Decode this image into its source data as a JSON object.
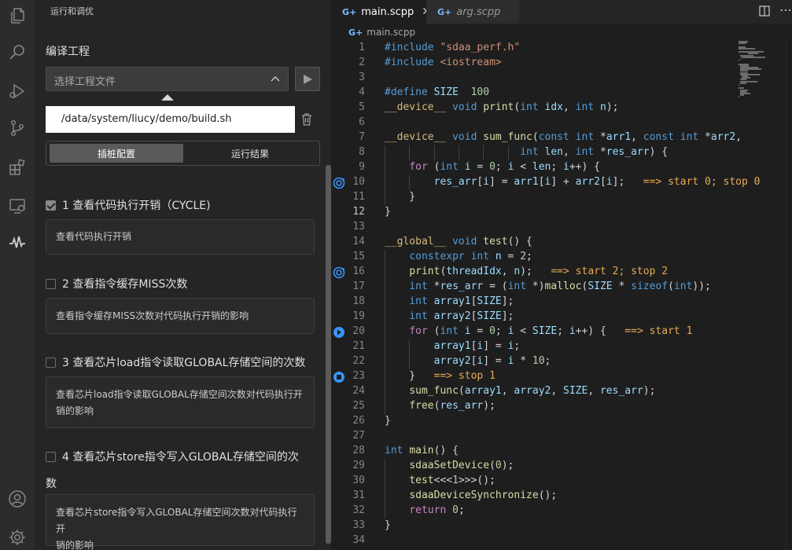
{
  "activity_bar": {
    "icons": [
      "files-icon",
      "search-icon",
      "run-debug-icon",
      "source-control-icon",
      "extensions-icon",
      "remote-explorer-icon",
      "waveform-icon",
      "account-icon",
      "settings-gear-icon"
    ]
  },
  "sidebar": {
    "title": "运行和调优",
    "section_title": "编译工程",
    "select_placeholder": "选择工程文件",
    "path_value": "/data/system/liucy/demo/build.sh",
    "tabs": [
      {
        "label": "插桩配置",
        "active": true
      },
      {
        "label": "运行结果",
        "active": false
      }
    ],
    "items": [
      {
        "title": "1 查看代码执行开销（CYCLE)",
        "checked": true,
        "desc": [
          "查看代码执行开销"
        ]
      },
      {
        "title": "2 查看指令缓存MISS次数",
        "checked": false,
        "desc": [
          "查看指令缓存MISS次数对代码执行开销的影响"
        ]
      },
      {
        "title": "3 查看芯片load指令读取GLOBAL存储空间的次数",
        "checked": false,
        "desc": [
          "查看芯片load指令读取GLOBAL存储空间次数对代码执行开",
          "销的影响"
        ]
      },
      {
        "title": "4 查看芯片store指令写入GLOBAL存储空间的次",
        "title_cont": "数",
        "checked": false,
        "desc": [
          "查看芯片store指令写入GLOBAL存储空间次数对代码执行开",
          "销的影响"
        ]
      }
    ]
  },
  "editor": {
    "tabs": [
      {
        "label": "main.scpp",
        "active": true,
        "icon": "G+"
      },
      {
        "label": "arg.scpp",
        "active": false,
        "icon": "G+"
      }
    ],
    "breadcrumb": "main.scpp",
    "current_line": 12,
    "lines": [
      {
        "n": "1"
      },
      {
        "n": "2"
      },
      {
        "n": "3"
      },
      {
        "n": "4"
      },
      {
        "n": "5"
      },
      {
        "n": "6"
      },
      {
        "n": "7"
      },
      {
        "n": "8"
      },
      {
        "n": "9"
      },
      {
        "n": "10"
      },
      {
        "n": "11"
      },
      {
        "n": "12"
      },
      {
        "n": "13"
      },
      {
        "n": "14"
      },
      {
        "n": "15"
      },
      {
        "n": "16"
      },
      {
        "n": "17"
      },
      {
        "n": "18"
      },
      {
        "n": "19"
      },
      {
        "n": "20"
      },
      {
        "n": "21"
      },
      {
        "n": "22"
      },
      {
        "n": "23"
      },
      {
        "n": "24"
      },
      {
        "n": "25"
      },
      {
        "n": "26"
      },
      {
        "n": "27"
      },
      {
        "n": "28"
      },
      {
        "n": "29"
      },
      {
        "n": "30"
      },
      {
        "n": "31"
      },
      {
        "n": "32"
      },
      {
        "n": "33"
      },
      {
        "n": "34"
      }
    ],
    "code": [
      [
        [
          "mac",
          "#include "
        ],
        [
          "str",
          "\"sdaa_perf.h\""
        ]
      ],
      [
        [
          "mac",
          "#include "
        ],
        [
          "str",
          "<iostream>"
        ]
      ],
      [],
      [
        [
          "mac",
          "#define "
        ],
        [
          "var",
          "SIZE"
        ],
        [
          "",
          "  "
        ],
        [
          "num",
          "100"
        ]
      ],
      [
        [
          "dev",
          "__device__"
        ],
        [
          "",
          " "
        ],
        [
          "kw",
          "void"
        ],
        [
          "",
          " "
        ],
        [
          "fn",
          "print"
        ],
        [
          "",
          "("
        ],
        [
          "kw",
          "int"
        ],
        [
          "",
          " "
        ],
        [
          "var",
          "idx"
        ],
        [
          "",
          ", "
        ],
        [
          "kw",
          "int"
        ],
        [
          "",
          " "
        ],
        [
          "var",
          "n"
        ],
        [
          "",
          ");"
        ]
      ],
      [],
      [
        [
          "dev",
          "__device__"
        ],
        [
          "",
          " "
        ],
        [
          "kw",
          "void"
        ],
        [
          "",
          " "
        ],
        [
          "fn",
          "sum_func"
        ],
        [
          "",
          "("
        ],
        [
          "kw",
          "const"
        ],
        [
          "",
          " "
        ],
        [
          "kw",
          "int"
        ],
        [
          "",
          " *"
        ],
        [
          "var",
          "arr1"
        ],
        [
          "",
          ", "
        ],
        [
          "kw",
          "const"
        ],
        [
          "",
          " "
        ],
        [
          "kw",
          "int"
        ],
        [
          "",
          " *"
        ],
        [
          "var",
          "arr2"
        ],
        [
          "",
          ","
        ]
      ],
      [
        [
          "",
          "                      "
        ],
        [
          "kw",
          "int"
        ],
        [
          "",
          " "
        ],
        [
          "var",
          "len"
        ],
        [
          "",
          ", "
        ],
        [
          "kw",
          "int"
        ],
        [
          "",
          " *"
        ],
        [
          "var",
          "res_arr"
        ],
        [
          "",
          ") {"
        ]
      ],
      [
        [
          "",
          "    "
        ],
        [
          "ctl",
          "for"
        ],
        [
          "",
          " ("
        ],
        [
          "kw",
          "int"
        ],
        [
          "",
          " "
        ],
        [
          "var",
          "i"
        ],
        [
          "",
          " = "
        ],
        [
          "num",
          "0"
        ],
        [
          "",
          "; "
        ],
        [
          "var",
          "i"
        ],
        [
          "",
          " < "
        ],
        [
          "var",
          "len"
        ],
        [
          "",
          "; "
        ],
        [
          "var",
          "i"
        ],
        [
          "",
          "++) {"
        ]
      ],
      [
        [
          "",
          "        "
        ],
        [
          "var",
          "res_arr"
        ],
        [
          "",
          "["
        ],
        [
          "var",
          "i"
        ],
        [
          "",
          "] = "
        ],
        [
          "var",
          "arr1"
        ],
        [
          "",
          "["
        ],
        [
          "var",
          "i"
        ],
        [
          "",
          "] + "
        ],
        [
          "var",
          "arr2"
        ],
        [
          "",
          "["
        ],
        [
          "var",
          "i"
        ],
        [
          "",
          "];   "
        ],
        [
          "ann",
          "==> start 0; stop 0"
        ]
      ],
      [
        [
          "",
          "    }"
        ]
      ],
      [
        [
          "",
          "}"
        ]
      ],
      [],
      [
        [
          "dev",
          "__global__"
        ],
        [
          "",
          " "
        ],
        [
          "kw",
          "void"
        ],
        [
          "",
          " "
        ],
        [
          "fn",
          "test"
        ],
        [
          "",
          "() {"
        ]
      ],
      [
        [
          "",
          "    "
        ],
        [
          "kw",
          "constexpr"
        ],
        [
          "",
          " "
        ],
        [
          "kw",
          "int"
        ],
        [
          "",
          " "
        ],
        [
          "var",
          "n"
        ],
        [
          "",
          " = "
        ],
        [
          "num",
          "2"
        ],
        [
          "",
          ";"
        ]
      ],
      [
        [
          "",
          "    "
        ],
        [
          "fn",
          "print"
        ],
        [
          "",
          "("
        ],
        [
          "var",
          "threadIdx"
        ],
        [
          "",
          ", "
        ],
        [
          "var",
          "n"
        ],
        [
          "",
          ");   "
        ],
        [
          "ann",
          "==> start 2; stop 2"
        ]
      ],
      [
        [
          "",
          "    "
        ],
        [
          "kw",
          "int"
        ],
        [
          "",
          " *"
        ],
        [
          "var",
          "res_arr"
        ],
        [
          "",
          " = ("
        ],
        [
          "kw",
          "int"
        ],
        [
          "",
          " *)"
        ],
        [
          "fn",
          "malloc"
        ],
        [
          "",
          "("
        ],
        [
          "var",
          "SIZE"
        ],
        [
          "",
          " * "
        ],
        [
          "kw",
          "sizeof"
        ],
        [
          "",
          "("
        ],
        [
          "kw",
          "int"
        ],
        [
          "",
          "));"
        ]
      ],
      [
        [
          "",
          "    "
        ],
        [
          "kw",
          "int"
        ],
        [
          "",
          " "
        ],
        [
          "var",
          "array1"
        ],
        [
          "",
          "["
        ],
        [
          "var",
          "SIZE"
        ],
        [
          "",
          "];"
        ]
      ],
      [
        [
          "",
          "    "
        ],
        [
          "kw",
          "int"
        ],
        [
          "",
          " "
        ],
        [
          "var",
          "array2"
        ],
        [
          "",
          "["
        ],
        [
          "var",
          "SIZE"
        ],
        [
          "",
          "];"
        ]
      ],
      [
        [
          "",
          "    "
        ],
        [
          "ctl",
          "for"
        ],
        [
          "",
          " ("
        ],
        [
          "kw",
          "int"
        ],
        [
          "",
          " "
        ],
        [
          "var",
          "i"
        ],
        [
          "",
          " = "
        ],
        [
          "num",
          "0"
        ],
        [
          "",
          "; "
        ],
        [
          "var",
          "i"
        ],
        [
          "",
          " < "
        ],
        [
          "var",
          "SIZE"
        ],
        [
          "",
          "; "
        ],
        [
          "var",
          "i"
        ],
        [
          "",
          "++) {   "
        ],
        [
          "ann",
          "==> start 1"
        ]
      ],
      [
        [
          "",
          "        "
        ],
        [
          "var",
          "array1"
        ],
        [
          "",
          "["
        ],
        [
          "var",
          "i"
        ],
        [
          "",
          "] = "
        ],
        [
          "var",
          "i"
        ],
        [
          "",
          ";"
        ]
      ],
      [
        [
          "",
          "        "
        ],
        [
          "var",
          "array2"
        ],
        [
          "",
          "["
        ],
        [
          "var",
          "i"
        ],
        [
          "",
          "] = "
        ],
        [
          "var",
          "i"
        ],
        [
          "",
          " * "
        ],
        [
          "num",
          "10"
        ],
        [
          "",
          ";"
        ]
      ],
      [
        [
          "",
          "    }   "
        ],
        [
          "ann",
          "==> stop 1"
        ]
      ],
      [
        [
          "",
          "    "
        ],
        [
          "fn",
          "sum_func"
        ],
        [
          "",
          "("
        ],
        [
          "var",
          "array1"
        ],
        [
          "",
          ", "
        ],
        [
          "var",
          "array2"
        ],
        [
          "",
          ", "
        ],
        [
          "var",
          "SIZE"
        ],
        [
          "",
          ", "
        ],
        [
          "var",
          "res_arr"
        ],
        [
          "",
          ");"
        ]
      ],
      [
        [
          "",
          "    "
        ],
        [
          "fn",
          "free"
        ],
        [
          "",
          "("
        ],
        [
          "var",
          "res_arr"
        ],
        [
          "",
          ");"
        ]
      ],
      [
        [
          "",
          "}"
        ]
      ],
      [],
      [
        [
          "kw",
          "int"
        ],
        [
          "",
          " "
        ],
        [
          "fn",
          "main"
        ],
        [
          "",
          "() {"
        ]
      ],
      [
        [
          "",
          "    "
        ],
        [
          "fn",
          "sdaaSetDevice"
        ],
        [
          "",
          "("
        ],
        [
          "num",
          "0"
        ],
        [
          "",
          ");"
        ]
      ],
      [
        [
          "",
          "    "
        ],
        [
          "fn",
          "test"
        ],
        [
          "",
          "<<<"
        ],
        [
          "num",
          "1"
        ],
        [
          "",
          ">>>();"
        ]
      ],
      [
        [
          "",
          "    "
        ],
        [
          "fn",
          "sdaaDeviceSynchronize"
        ],
        [
          "",
          "();"
        ]
      ],
      [
        [
          "",
          "    "
        ],
        [
          "ctl",
          "return"
        ],
        [
          "",
          " "
        ],
        [
          "num",
          "0"
        ],
        [
          "",
          ";"
        ]
      ],
      [
        [
          "",
          "}"
        ]
      ],
      []
    ],
    "glyphs": {
      "10": "start-stop",
      "16": "start-stop",
      "20": "start",
      "23": "stop"
    },
    "colors": {
      "accent": "#75beff",
      "annotation": "#e8ab53",
      "glyph": "#3794ff"
    }
  }
}
